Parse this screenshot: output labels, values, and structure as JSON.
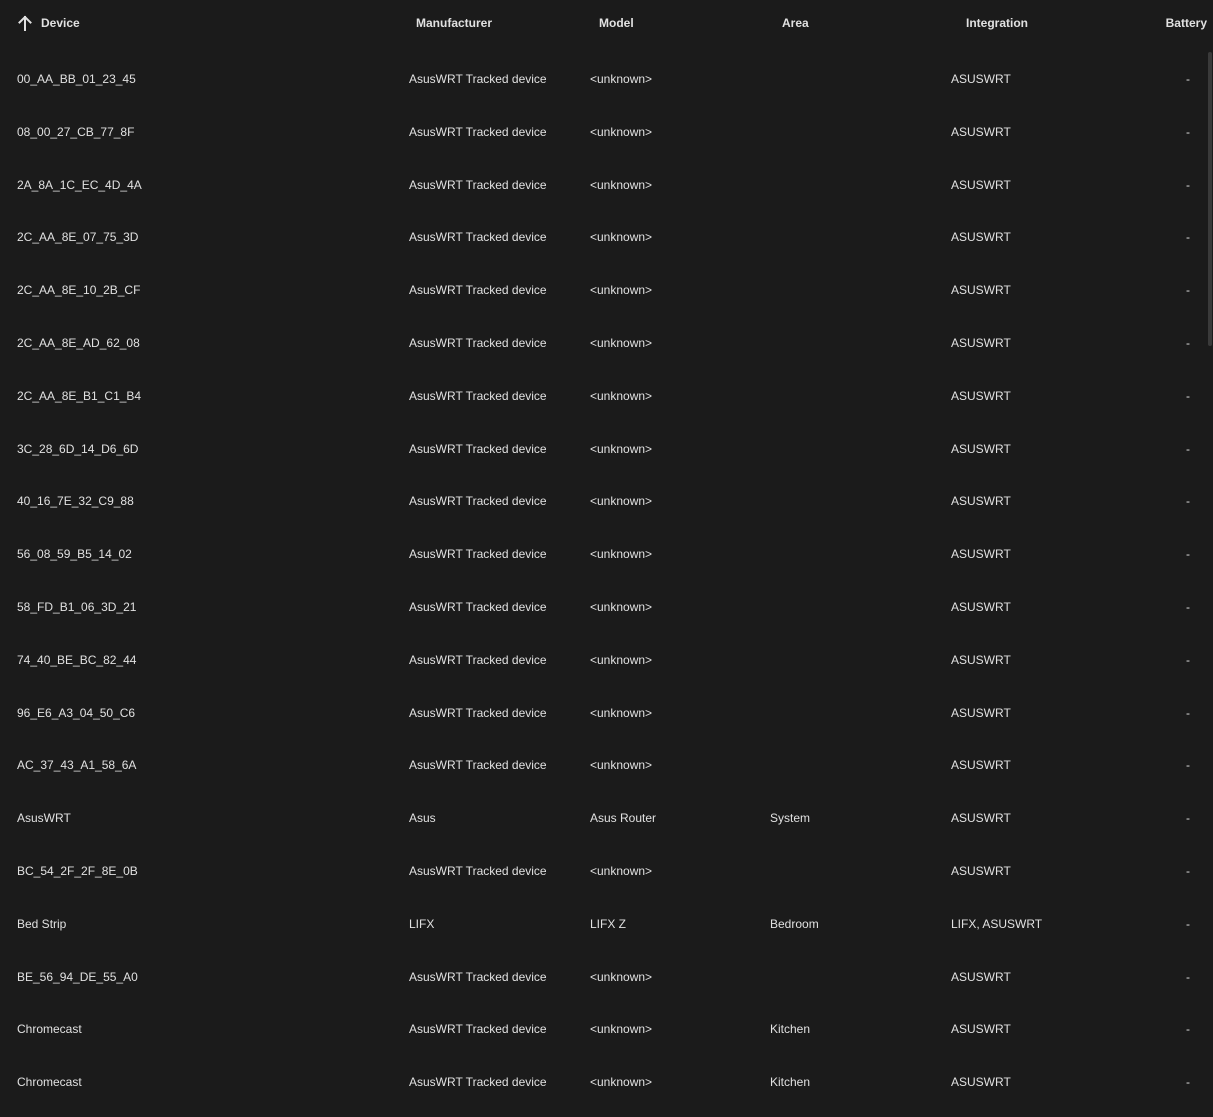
{
  "header": {
    "device": "Device",
    "manufacturer": "Manufacturer",
    "model": "Model",
    "area": "Area",
    "integration": "Integration",
    "battery": "Battery",
    "sort_icon": "arrow-up-icon"
  },
  "rows": [
    {
      "device": "00_AA_BB_01_23_45",
      "manufacturer": "AsusWRT Tracked device",
      "model": "<unknown>",
      "area": "",
      "integration": "ASUSWRT",
      "battery": "-"
    },
    {
      "device": "08_00_27_CB_77_8F",
      "manufacturer": "AsusWRT Tracked device",
      "model": "<unknown>",
      "area": "",
      "integration": "ASUSWRT",
      "battery": "-"
    },
    {
      "device": "2A_8A_1C_EC_4D_4A",
      "manufacturer": "AsusWRT Tracked device",
      "model": "<unknown>",
      "area": "",
      "integration": "ASUSWRT",
      "battery": "-"
    },
    {
      "device": "2C_AA_8E_07_75_3D",
      "manufacturer": "AsusWRT Tracked device",
      "model": "<unknown>",
      "area": "",
      "integration": "ASUSWRT",
      "battery": "-"
    },
    {
      "device": "2C_AA_8E_10_2B_CF",
      "manufacturer": "AsusWRT Tracked device",
      "model": "<unknown>",
      "area": "",
      "integration": "ASUSWRT",
      "battery": "-"
    },
    {
      "device": "2C_AA_8E_AD_62_08",
      "manufacturer": "AsusWRT Tracked device",
      "model": "<unknown>",
      "area": "",
      "integration": "ASUSWRT",
      "battery": "-"
    },
    {
      "device": "2C_AA_8E_B1_C1_B4",
      "manufacturer": "AsusWRT Tracked device",
      "model": "<unknown>",
      "area": "",
      "integration": "ASUSWRT",
      "battery": "-"
    },
    {
      "device": "3C_28_6D_14_D6_6D",
      "manufacturer": "AsusWRT Tracked device",
      "model": "<unknown>",
      "area": "",
      "integration": "ASUSWRT",
      "battery": "-"
    },
    {
      "device": "40_16_7E_32_C9_88",
      "manufacturer": "AsusWRT Tracked device",
      "model": "<unknown>",
      "area": "",
      "integration": "ASUSWRT",
      "battery": "-"
    },
    {
      "device": "56_08_59_B5_14_02",
      "manufacturer": "AsusWRT Tracked device",
      "model": "<unknown>",
      "area": "",
      "integration": "ASUSWRT",
      "battery": "-"
    },
    {
      "device": "58_FD_B1_06_3D_21",
      "manufacturer": "AsusWRT Tracked device",
      "model": "<unknown>",
      "area": "",
      "integration": "ASUSWRT",
      "battery": "-"
    },
    {
      "device": "74_40_BE_BC_82_44",
      "manufacturer": "AsusWRT Tracked device",
      "model": "<unknown>",
      "area": "",
      "integration": "ASUSWRT",
      "battery": "-"
    },
    {
      "device": "96_E6_A3_04_50_C6",
      "manufacturer": "AsusWRT Tracked device",
      "model": "<unknown>",
      "area": "",
      "integration": "ASUSWRT",
      "battery": "-"
    },
    {
      "device": "AC_37_43_A1_58_6A",
      "manufacturer": "AsusWRT Tracked device",
      "model": "<unknown>",
      "area": "",
      "integration": "ASUSWRT",
      "battery": "-"
    },
    {
      "device": "AsusWRT",
      "manufacturer": "Asus",
      "model": "Asus Router",
      "area": "System",
      "integration": "ASUSWRT",
      "battery": "-"
    },
    {
      "device": "BC_54_2F_2F_8E_0B",
      "manufacturer": "AsusWRT Tracked device",
      "model": "<unknown>",
      "area": "",
      "integration": "ASUSWRT",
      "battery": "-"
    },
    {
      "device": "Bed Strip",
      "manufacturer": "LIFX",
      "model": "LIFX Z",
      "area": "Bedroom",
      "integration": "LIFX, ASUSWRT",
      "battery": "-"
    },
    {
      "device": "BE_56_94_DE_55_A0",
      "manufacturer": "AsusWRT Tracked device",
      "model": "<unknown>",
      "area": "",
      "integration": "ASUSWRT",
      "battery": "-"
    },
    {
      "device": "Chromecast",
      "manufacturer": "AsusWRT Tracked device",
      "model": "<unknown>",
      "area": "Kitchen",
      "integration": "ASUSWRT",
      "battery": "-"
    },
    {
      "device": "Chromecast",
      "manufacturer": "AsusWRT Tracked device",
      "model": "<unknown>",
      "area": "Kitchen",
      "integration": "ASUSWRT",
      "battery": "-"
    }
  ]
}
